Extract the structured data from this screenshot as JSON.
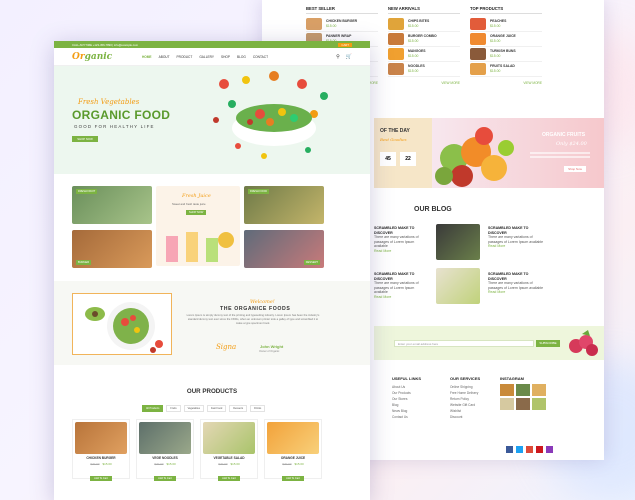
{
  "colors": {
    "accent": "#7cb342",
    "orange": "#f39c12",
    "pink_band": "#f6c8cc"
  },
  "back_page": {
    "categories": [
      {
        "title": "BEST SELLER",
        "items": [
          {
            "name": "CHICKEN BURGER",
            "price": "$15.00",
            "color": "#d9a066"
          },
          {
            "name": "PANNER WRAP",
            "price": "$15.00",
            "color": "#c49a6c"
          },
          {
            "name": "CHEESE BURGER",
            "price": "$15.00",
            "color": "#d48a3a"
          },
          {
            "name": "VEGGIE BURGER",
            "price": "$15.00",
            "color": "#9bb86a"
          }
        ]
      },
      {
        "title": "NEW ARRIVALS",
        "items": [
          {
            "name": "CHIPS BITES",
            "price": "$15.00",
            "color": "#e0a43a"
          },
          {
            "name": "BURGER COMBO",
            "price": "$15.00",
            "color": "#c87a3a"
          },
          {
            "name": "MANGOES",
            "price": "$15.00",
            "color": "#f0a030"
          },
          {
            "name": "NOODLES",
            "price": "$15.00",
            "color": "#c9834a"
          }
        ]
      },
      {
        "title": "TOP PRODUCTS",
        "items": [
          {
            "name": "PEACHES",
            "price": "$15.00",
            "color": "#e25c3a"
          },
          {
            "name": "ORANGE JUICE",
            "price": "$15.00",
            "color": "#f08a30"
          },
          {
            "name": "TURKISH BUNS",
            "price": "$15.00",
            "color": "#8a5a3a"
          },
          {
            "name": "FRUITS SALAD",
            "price": "$15.00",
            "color": "#e4a04a"
          }
        ]
      }
    ],
    "view_all": "VIEW MORE",
    "deal": {
      "title": "OF THE DAY",
      "subtitle": "Best Goodies",
      "days": "45",
      "hours": "22"
    },
    "promo": {
      "title": "ORGANIC FRUITS",
      "price": "Only $24.00",
      "button": "Shop Now"
    },
    "blog_heading": "OUR BLOG",
    "blog_posts": [
      {
        "title": "SCRAMBLED MAKE TO DISCOVER",
        "text": "There are many variations of passages of Lorem Ipsum available",
        "link": "Read More"
      },
      {
        "title": "SCRAMBLED MAKE TO DISCOVER",
        "text": "There are many variations of passages of Lorem Ipsum available",
        "link": "Read More"
      },
      {
        "title": "SCRAMBLED MAKE TO DISCOVER",
        "text": "There are many variations of passages of Lorem Ipsum available",
        "link": "Read More"
      },
      {
        "title": "SCRAMBLED MAKE TO DISCOVER",
        "text": "There are many variations of passages of Lorem Ipsum available",
        "link": "Read More"
      }
    ],
    "newsletter": {
      "placeholder": "Enter your email address here",
      "button": "SUBSCRIBE"
    },
    "footer": {
      "useful_links": {
        "title": "USEFUL LINKS",
        "items": [
          "About Us",
          "Our Products",
          "Our Stores",
          "Blog",
          "News Blog",
          "Contact Us"
        ]
      },
      "our_services": {
        "title": "OUR SERVICES",
        "items": [
          "Online Shipping",
          "Free Home Delivery",
          "Return Policy",
          "Website Gift Card",
          "Wishlist",
          "Discount"
        ]
      },
      "instagram": {
        "title": "INSTAGRAM"
      }
    }
  },
  "front_page": {
    "topbar": {
      "contact": "CALL ANYTIME +123-456-7890  |  info@example.com",
      "cart": "CART"
    },
    "logo": {
      "prefix": "Or",
      "suffix": "ganic"
    },
    "menu": [
      "HOME",
      "ABOUT",
      "PRODUCT",
      "GALLERY",
      "SHOP",
      "BLOG",
      "CONTACT"
    ],
    "hero": {
      "subtitle": "Fresh Vegetables",
      "title": "ORGANIC FOOD",
      "tagline": "GOOD FOR HEALTHY LIFE",
      "button": "SHOP NOW"
    },
    "tiles": [
      {
        "label": "FRESH FRUIT",
        "color": "#6a8f5b"
      },
      {
        "label": "Fresh Juice",
        "text": "Sweet and fresh taste juice",
        "button": "SHOP NOW",
        "color": "#fcf3e8"
      },
      {
        "label": "FRESH FOOD",
        "color": "#6e7a48"
      },
      {
        "label": "BURGER",
        "color": "#a56a3a"
      },
      {
        "label": "COCKTAIL",
        "color": "#f4c6b5"
      },
      {
        "label": "DESSERT",
        "color": "#5f6b7a"
      }
    ],
    "about": {
      "welcome": "Welcome!",
      "title": "THE ORGANICE FOODS",
      "text": "Lorem Ipsum is simply dummy text of the printing and typesetting industry. Lorem Ipsum has been the industry's standard dummy text ever since the 1500s, when an unknown printer took a galley of type and scrambled it to make a type specimen book.",
      "signature": "Signa",
      "name": "John Wright",
      "role": "Owner of Organic"
    },
    "products_heading": "OUR PRODUCTS",
    "tabs": [
      "All Products",
      "Fruits",
      "Vegetables",
      "Fast Food",
      "Desserts",
      "Drinks"
    ],
    "products": [
      {
        "name": "CHICKEN BURGER",
        "old": "$20.00",
        "price": "$15.00",
        "button": "Add To Cart",
        "color": "#b8743a"
      },
      {
        "name": "VEGE NOODLES",
        "old": "$20.00",
        "price": "$15.00",
        "button": "Add To Cart",
        "color": "#5d6f6a"
      },
      {
        "name": "VEGETABLE SALAD",
        "old": "$20.00",
        "price": "$15.00",
        "button": "Add To Cart",
        "color": "#e4d7b5"
      },
      {
        "name": "ORANGE JUICE",
        "old": "$20.00",
        "price": "$15.00",
        "button": "Add To Cart",
        "color": "#f2a23a"
      }
    ]
  }
}
